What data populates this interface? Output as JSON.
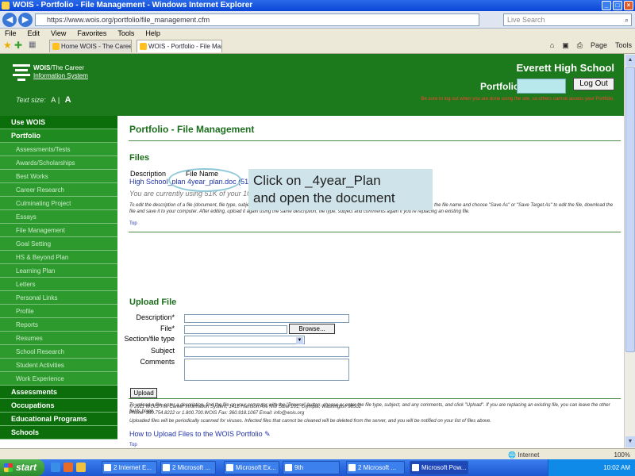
{
  "window": {
    "title": "WOIS - Portfolio - File Management - Windows Internet Explorer",
    "url": "https://www.wois.org/portfolio/file_management.cfm",
    "search_placeholder": "Live Search"
  },
  "menu": [
    "File",
    "Edit",
    "View",
    "Favorites",
    "Tools",
    "Help"
  ],
  "tabs": [
    {
      "label": "Home WOIS - The Career..."
    },
    {
      "label": "WOIS - Portfolio - File Man..."
    }
  ],
  "toolbar_tools": [
    "Page",
    "Tools"
  ],
  "header": {
    "logo_line1_bold": "WOIS",
    "logo_line1": "/The Career",
    "logo_line2": "Information System",
    "textsize_label": "Text size:",
    "textsize_small": "A",
    "textsize_large": "A",
    "school": "Everett High School",
    "portfolio_label": "Portfolio:",
    "logout_label": "Log Out",
    "logout_note": "Be sure to log out when you are done using the site, so others cannot access your Portfolio."
  },
  "sidebar": {
    "use_wois": "Use WOIS",
    "portfolio": "Portfolio",
    "items": [
      "Assessments/Tests",
      "Awards/Scholarships",
      "Best Works",
      "Career Research",
      "Culminating Project",
      "Essays",
      "File Management",
      "Goal Setting",
      "HS & Beyond Plan",
      "Learning Plan",
      "Letters",
      "Personal Links",
      "Profile",
      "Reports",
      "Resumes",
      "School Research",
      "Student Activities",
      "Work Experience"
    ],
    "bottom": [
      "Assessments",
      "Occupations",
      "Educational Programs",
      "Schools"
    ]
  },
  "content": {
    "page_title": "Portfolio - File Management",
    "files_heading": "Files",
    "col_description": "Description",
    "col_filename": "File Name",
    "file_row": "High School_plan   4year_plan.doc (51K) [edit] [delete]",
    "using_note": "You are currently using 51K of your 10 MB of storage.",
    "files_help": "To edit the description of a file (document, file type, subject or comments), click on the edit link. To make changes to the content of a file, click on the file name and choose \"Save As\" or \"Save Target As\" to edit the file, download the file and save it to your computer. After editing, upload it again using the same description, file type, subject and comments again if you're replacing an existing file.",
    "top_link": "Top",
    "upload_heading": "Upload File",
    "label_description": "Description*",
    "label_file": "File*",
    "browse_label": "Browse...",
    "label_section": "Section/file type",
    "label_subject": "Subject",
    "label_comments": "Comments",
    "upload_label": "Upload",
    "upload_help": "To upload a file, enter a description, find the file on your computer with the \"Browse\" button, choose or enter the file type, subject, and any comments, and click \"Upload\". If you are replacing an existing file, you can leave the other fields blank.",
    "upload_note": "Uploaded files will be periodically scanned for viruses. Infected files that cannot be cleaned will be deleted from the server, and you will be notified on your list of files above.",
    "howto_link": "How to Upload Files to the WOIS Portfolio",
    "footer1": "© 2011 WOIS/The Career Information System, 1415 Harrison Ave NW Suite 201, Olympia, Washington 98502",
    "footer2": "Phone: 360.754.8222 or 1.800.700.WOIS Fax: 360.918.1067 Email: info@wois.org"
  },
  "callout": {
    "line1": "Click on _4year_Plan",
    "line2": "and open the document"
  },
  "statusbar": {
    "zone": "Internet",
    "zoom": "100%"
  },
  "taskbar": {
    "start": "start",
    "tasks": [
      "2 Internet E...",
      "2 Microsoft ...",
      "Microsoft Ex...",
      "9th",
      "2 Microsoft ...",
      "Microsoft Pow..."
    ],
    "clock": "10:02 AM"
  },
  "colors": {
    "header_green": "#1c7a1c",
    "sidebar_green": "#2d9a2d",
    "title_green": "#1c6e1c",
    "link_blue": "#2233aa",
    "callout_bg": "#cfe3ea"
  }
}
